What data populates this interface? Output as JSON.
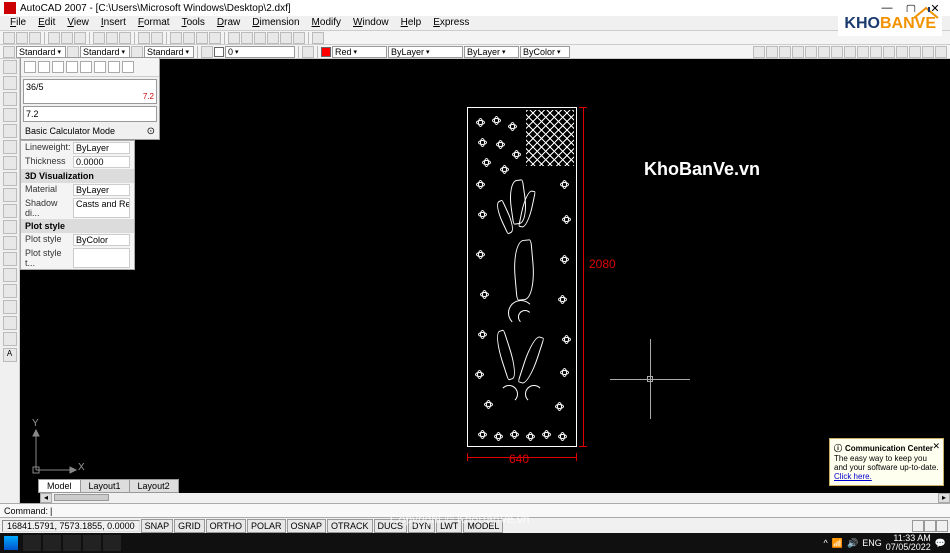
{
  "title": "AutoCAD 2007 - [C:\\Users\\Microsoft Windows\\Desktop\\2.dxf]",
  "menus": [
    "File",
    "Edit",
    "View",
    "Insert",
    "Format",
    "Tools",
    "Draw",
    "Dimension",
    "Modify",
    "Window",
    "Help",
    "Express"
  ],
  "toolbar2": {
    "style1": "Standard",
    "style2": "Standard",
    "style3": "Standard",
    "layer": "0",
    "color": "Red",
    "ltype": "ByLayer",
    "lweight": "ByLayer",
    "pstyle": "ByColor"
  },
  "calc": {
    "expr": "36/5",
    "result_small": "7.2",
    "result": "7.2",
    "mode": "Basic Calculator Mode"
  },
  "props": {
    "lw_label": "Lineweight:",
    "lw_val": "ByLayer",
    "th_label": "Thickness",
    "th_val": "0.0000",
    "sect_3d": "3D Visualization",
    "mat_label": "Material",
    "mat_val": "ByLayer",
    "shd_label": "Shadow di...",
    "shd_val": "Casts and Receives...",
    "sect_plot": "Plot style",
    "ps_label": "Plot style",
    "ps_val": "ByColor",
    "ps2_label": "Plot style t..."
  },
  "dims": {
    "height": "2080",
    "width": "640"
  },
  "watermark": "KhoBanVe.vn",
  "copyright": "Copyright © KhoBanVe.vn",
  "tabs": [
    "Model",
    "Layout1",
    "Layout2"
  ],
  "cmd": {
    "prompt": "Command:",
    "value": "|"
  },
  "status": {
    "coords": "16841.5791, 7573.1855, 0.0000",
    "toggles": [
      "SNAP",
      "GRID",
      "ORTHO",
      "POLAR",
      "OSNAP",
      "OTRACK",
      "DUCS",
      "DYN",
      "LWT",
      "MODEL"
    ]
  },
  "comm": {
    "title": "Communication Center",
    "body": "The easy way to keep you and your software up-to-date.",
    "link": "Click here."
  },
  "tray": {
    "lang": "ENG",
    "time": "11:33 AM",
    "date": "07/05/2022"
  },
  "logo": {
    "a": "KHO",
    "b": "BANVE"
  },
  "ucs": {
    "x": "X",
    "y": "Y"
  }
}
